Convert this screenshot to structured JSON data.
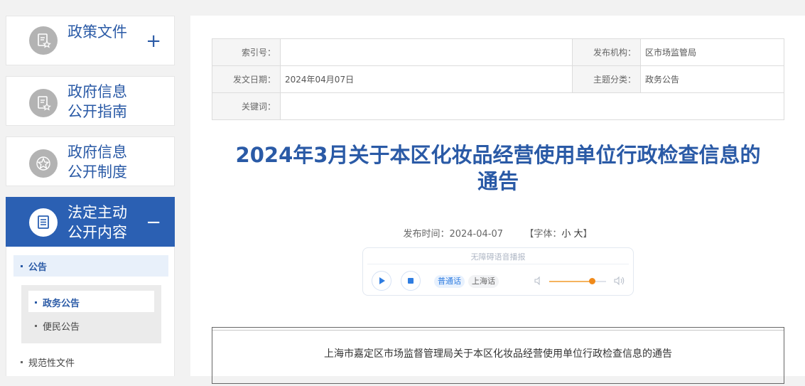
{
  "sidebar": {
    "items": [
      {
        "label_line1": "政策文件",
        "label_line2": "",
        "sign": "+",
        "icon": "document-star-icon"
      },
      {
        "label_line1": "政府信息",
        "label_line2": "公开指南",
        "sign": "",
        "icon": "document-star-icon"
      },
      {
        "label_line1": "政府信息",
        "label_line2": "公开制度",
        "sign": "",
        "icon": "star-badge-icon"
      },
      {
        "label_line1": "法定主动",
        "label_line2": "公开内容",
        "sign": "−",
        "icon": "list-document-icon"
      }
    ],
    "submenu": {
      "group_label": "公告",
      "children": [
        "政务公告",
        "便民公告"
      ],
      "next_label": "规范性文件"
    }
  },
  "meta": {
    "index_label": "索引号：",
    "index_value": "",
    "agency_label": "发布机构：",
    "agency_value": "区市场监管局",
    "date_label": "发文日期：",
    "date_value": "2024年04月07日",
    "topic_label": "主题分类：",
    "topic_value": "政务公告",
    "keywords_label": "关键词：",
    "keywords_value": ""
  },
  "article": {
    "title_line1": "2024年3月关于本区化妆品经营使用单位行政检查信息的",
    "title_line2": "通告",
    "publish_time": "发布时间：2024-04-07",
    "font_label_open": "【字体：",
    "font_small": "小",
    "font_large": "大",
    "font_label_close": "】",
    "body_first_line": "上海市嘉定区市场监督管理局关于本区化妆品经营使用单位行政检查信息的通告"
  },
  "player": {
    "hint": "无障碍语音播报",
    "lang_putonghua": "普通话",
    "lang_shanghai": "上海话",
    "volume_level": 0.75
  },
  "colors": {
    "accent": "#2b60b3",
    "title": "#2a5aa6",
    "player_blue": "#2f7de1",
    "volume_orange": "#f08a1a"
  }
}
